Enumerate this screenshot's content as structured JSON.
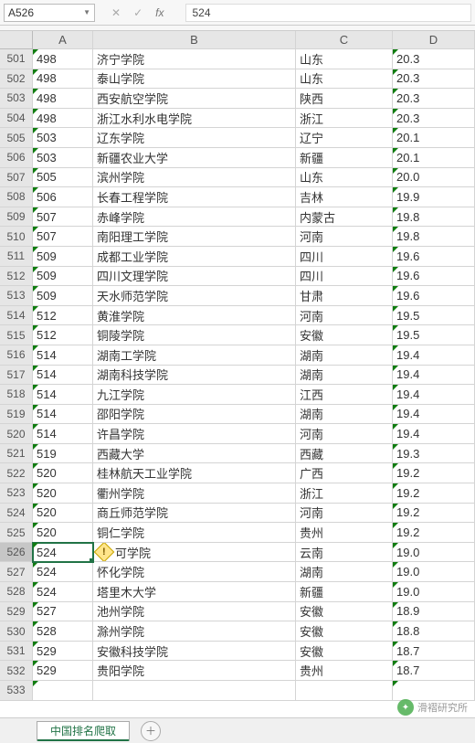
{
  "nameBox": "A526",
  "formula": "524",
  "columns": [
    "A",
    "B",
    "C",
    "D"
  ],
  "activeRow": "526",
  "activeCol": "A",
  "sheetTab": "中国排名爬取",
  "watermark": "滑褶研究所",
  "chart_data": {
    "type": "table",
    "columns": [
      "row",
      "A",
      "B",
      "C",
      "D"
    ],
    "rows": [
      {
        "row": "501",
        "A": "498",
        "B": "济宁学院",
        "C": "山东",
        "D": "20.3"
      },
      {
        "row": "502",
        "A": "498",
        "B": "泰山学院",
        "C": "山东",
        "D": "20.3"
      },
      {
        "row": "503",
        "A": "498",
        "B": "西安航空学院",
        "C": "陕西",
        "D": "20.3"
      },
      {
        "row": "504",
        "A": "498",
        "B": "浙江水利水电学院",
        "C": "浙江",
        "D": "20.3"
      },
      {
        "row": "505",
        "A": "503",
        "B": "辽东学院",
        "C": "辽宁",
        "D": "20.1"
      },
      {
        "row": "506",
        "A": "503",
        "B": "新疆农业大学",
        "C": "新疆",
        "D": "20.1"
      },
      {
        "row": "507",
        "A": "505",
        "B": "滨州学院",
        "C": "山东",
        "D": "20.0"
      },
      {
        "row": "508",
        "A": "506",
        "B": "长春工程学院",
        "C": "吉林",
        "D": "19.9"
      },
      {
        "row": "509",
        "A": "507",
        "B": "赤峰学院",
        "C": "内蒙古",
        "D": "19.8"
      },
      {
        "row": "510",
        "A": "507",
        "B": "南阳理工学院",
        "C": "河南",
        "D": "19.8"
      },
      {
        "row": "511",
        "A": "509",
        "B": "成都工业学院",
        "C": "四川",
        "D": "19.6"
      },
      {
        "row": "512",
        "A": "509",
        "B": "四川文理学院",
        "C": "四川",
        "D": "19.6"
      },
      {
        "row": "513",
        "A": "509",
        "B": "天水师范学院",
        "C": "甘肃",
        "D": "19.6"
      },
      {
        "row": "514",
        "A": "512",
        "B": "黄淮学院",
        "C": "河南",
        "D": "19.5"
      },
      {
        "row": "515",
        "A": "512",
        "B": "铜陵学院",
        "C": "安徽",
        "D": "19.5"
      },
      {
        "row": "516",
        "A": "514",
        "B": "湖南工学院",
        "C": "湖南",
        "D": "19.4"
      },
      {
        "row": "517",
        "A": "514",
        "B": "湖南科技学院",
        "C": "湖南",
        "D": "19.4"
      },
      {
        "row": "518",
        "A": "514",
        "B": "九江学院",
        "C": "江西",
        "D": "19.4"
      },
      {
        "row": "519",
        "A": "514",
        "B": "邵阳学院",
        "C": "湖南",
        "D": "19.4"
      },
      {
        "row": "520",
        "A": "514",
        "B": "许昌学院",
        "C": "河南",
        "D": "19.4"
      },
      {
        "row": "521",
        "A": "519",
        "B": "西藏大学",
        "C": "西藏",
        "D": "19.3"
      },
      {
        "row": "522",
        "A": "520",
        "B": "桂林航天工业学院",
        "C": "广西",
        "D": "19.2"
      },
      {
        "row": "523",
        "A": "520",
        "B": "衢州学院",
        "C": "浙江",
        "D": "19.2"
      },
      {
        "row": "524",
        "A": "520",
        "B": "商丘师范学院",
        "C": "河南",
        "D": "19.2"
      },
      {
        "row": "525",
        "A": "520",
        "B": "铜仁学院",
        "C": "贵州",
        "D": "19.2"
      },
      {
        "row": "526",
        "A": "524",
        "B": "可学院",
        "C": "云南",
        "D": "19.0",
        "smartTag": true
      },
      {
        "row": "527",
        "A": "524",
        "B": "怀化学院",
        "C": "湖南",
        "D": "19.0"
      },
      {
        "row": "528",
        "A": "524",
        "B": "塔里木大学",
        "C": "新疆",
        "D": "19.0"
      },
      {
        "row": "529",
        "A": "527",
        "B": "池州学院",
        "C": "安徽",
        "D": "18.9"
      },
      {
        "row": "530",
        "A": "528",
        "B": "滁州学院",
        "C": "安徽",
        "D": "18.8"
      },
      {
        "row": "531",
        "A": "529",
        "B": "安徽科技学院",
        "C": "安徽",
        "D": "18.7"
      },
      {
        "row": "532",
        "A": "529",
        "B": "贵阳学院",
        "C": "贵州",
        "D": "18.7"
      },
      {
        "row": "533",
        "A": "",
        "B": "",
        "C": "",
        "D": ""
      }
    ]
  }
}
